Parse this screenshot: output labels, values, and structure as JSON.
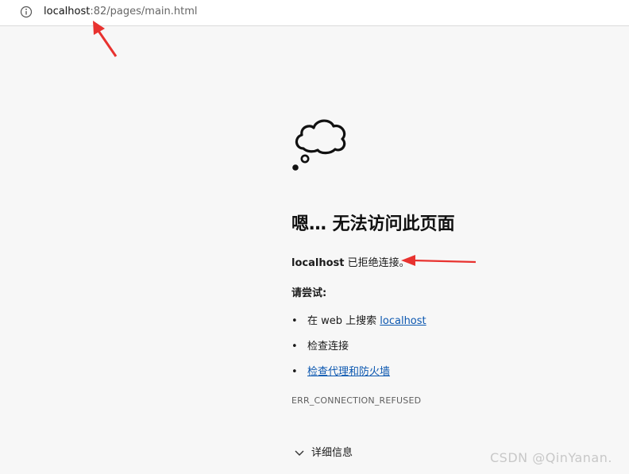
{
  "address_bar": {
    "url_host": "localhost",
    "url_rest": ":82/pages/main.html",
    "info_icon": "info-circle-icon"
  },
  "error_page": {
    "icon": "thought-cloud-icon",
    "title": "嗯… 无法访问此页面",
    "refused_host": "localhost",
    "refused_text": " 已拒绝连接。",
    "try_heading": "请尝试:",
    "suggestions": [
      {
        "bullet": "•",
        "prefix": "在 web 上搜索 ",
        "link": "localhost"
      },
      {
        "bullet": "•",
        "text": "检查连接"
      },
      {
        "bullet": "•",
        "link": "检查代理和防火墙"
      }
    ],
    "error_code": "ERR_CONNECTION_REFUSED",
    "details_label": "详细信息",
    "details_icon": "chevron-down-icon"
  },
  "annotations": {
    "arrow_color": "#e8322f"
  },
  "watermark": "CSDN @QinYanan."
}
